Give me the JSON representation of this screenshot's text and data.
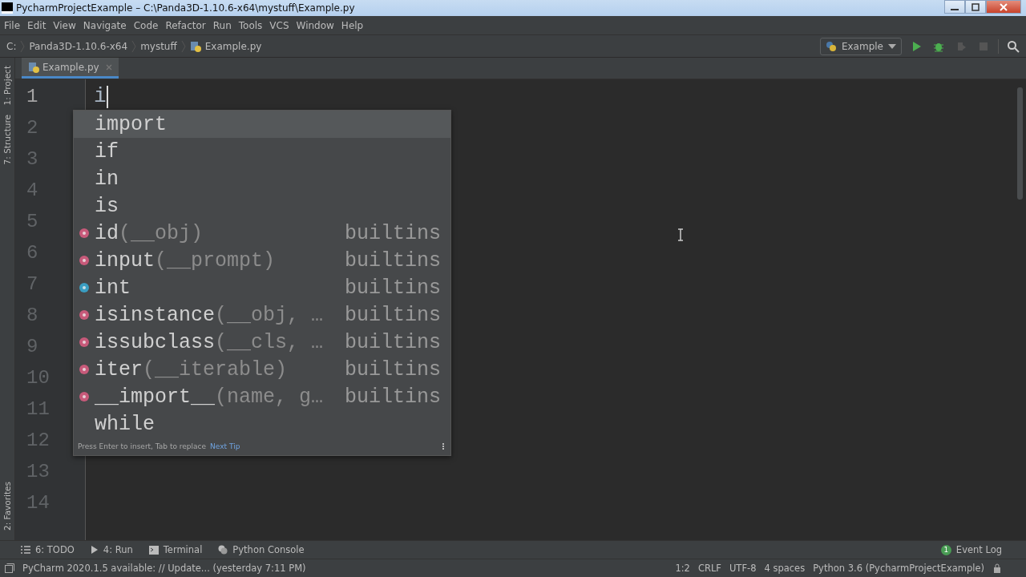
{
  "window": {
    "title": "PycharmProjectExample – C:\\Panda3D-1.10.6-x64\\mystuff\\Example.py"
  },
  "menu": [
    "File",
    "Edit",
    "View",
    "Navigate",
    "Code",
    "Refactor",
    "Run",
    "Tools",
    "VCS",
    "Window",
    "Help"
  ],
  "breadcrumbs": [
    "C:",
    "Panda3D-1.10.6-x64",
    "mystuff",
    "Example.py"
  ],
  "run_toolbar": {
    "configuration": "Example",
    "buttons": [
      {
        "kind": "run",
        "disabled": false
      },
      {
        "kind": "debug",
        "disabled": false
      },
      {
        "kind": "coverage",
        "disabled": true
      },
      {
        "kind": "stop",
        "disabled": true
      }
    ]
  },
  "left_tool_strip": [
    "1: Project",
    "7: Structure",
    "2: Favorites"
  ],
  "tabs": [
    {
      "label": "Example.py",
      "selected": true
    }
  ],
  "editor": {
    "line_numbers": [
      "1",
      "2",
      "3",
      "4",
      "5",
      "6",
      "7",
      "8",
      "9",
      "10",
      "11",
      "12",
      "13",
      "14"
    ],
    "lines": [
      "i"
    ]
  },
  "completion": {
    "items": [
      {
        "kind": "keyword",
        "label": "import",
        "selected": true
      },
      {
        "kind": "keyword",
        "label": "if",
        "selected": false
      },
      {
        "kind": "keyword",
        "label": "in",
        "selected": false
      },
      {
        "kind": "keyword",
        "label": "is",
        "selected": false
      },
      {
        "kind": "function",
        "label": "id",
        "params": "(__obj)",
        "detail": "builtins",
        "selected": false
      },
      {
        "kind": "function",
        "label": "input",
        "params": "(__prompt)",
        "detail": "builtins",
        "selected": false
      },
      {
        "kind": "class",
        "label": "int",
        "detail": "builtins",
        "selected": false
      },
      {
        "kind": "function",
        "label": "isinstance",
        "params": "(__obj, …",
        "detail": "builtins",
        "selected": false
      },
      {
        "kind": "function",
        "label": "issubclass",
        "params": "(__cls, …",
        "detail": "builtins",
        "selected": false
      },
      {
        "kind": "function",
        "label": "iter",
        "params": "(__iterable)",
        "detail": "builtins",
        "selected": false
      },
      {
        "kind": "function",
        "label": "__import__",
        "params": "(name, g…",
        "detail": "builtins",
        "selected": false
      },
      {
        "kind": "keyword",
        "label": "while",
        "selected": false
      }
    ],
    "hint": "Press Enter to insert, Tab to replace",
    "hint_link": "Next Tip"
  },
  "bottom_tools": [
    {
      "kind": "list",
      "label": "6: TODO"
    },
    {
      "kind": "run",
      "label": "4: Run"
    },
    {
      "kind": "terminal",
      "label": "Terminal"
    },
    {
      "kind": "python",
      "label": "Python Console"
    }
  ],
  "event_log": {
    "count": "1",
    "label": "Event Log"
  },
  "status_bar": {
    "message": "PyCharm 2020.1.5 available: // Update... (yesterday 7:11 PM)",
    "items": [
      "1:2",
      "CRLF",
      "UTF-8",
      "4 spaces",
      "Python 3.6 (PycharmProjectExample)"
    ]
  }
}
